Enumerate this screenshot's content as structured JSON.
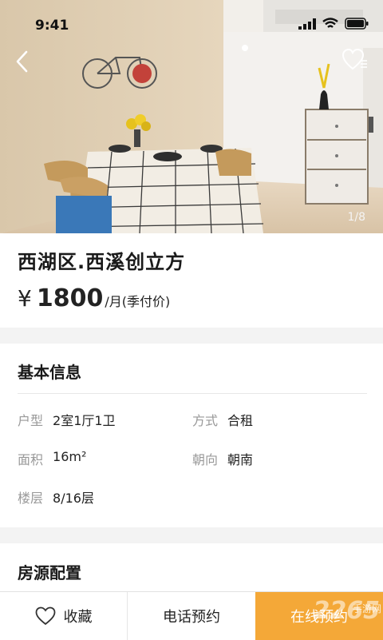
{
  "status_bar": {
    "time": "9:41"
  },
  "gallery": {
    "counter": "1/8"
  },
  "listing": {
    "title": "西湖区.西溪创立方",
    "price_currency": "¥",
    "price_value": "1800",
    "price_unit": "/月(季付价)"
  },
  "basic_info": {
    "heading": "基本信息",
    "items": [
      {
        "label": "户型",
        "value": "2室1厅1卫"
      },
      {
        "label": "方式",
        "value": "合租"
      },
      {
        "label": "面积",
        "value": "16m²"
      },
      {
        "label": "朝向",
        "value": "朝南"
      },
      {
        "label": "楼层",
        "value": "8/16层"
      }
    ]
  },
  "amenities": {
    "heading": "房源配置"
  },
  "bottom_bar": {
    "favorite_label": "收藏",
    "call_label": "电话预约",
    "online_label": "在线预约",
    "watermark": "2265",
    "watermark_sub": "手游网"
  },
  "colors": {
    "accent": "#f4a838"
  }
}
